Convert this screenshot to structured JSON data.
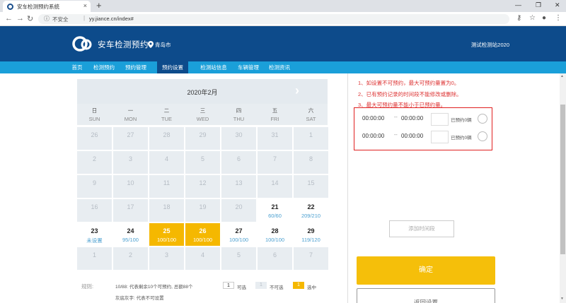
{
  "browser": {
    "tab_title": "安车检测预约系统",
    "tab_close": "×",
    "new_tab": "+",
    "security_label": "不安全",
    "separator": "|",
    "url": "yy.jiance.cn/index#"
  },
  "header": {
    "brand": "安车检测预约",
    "city": "青岛市",
    "station": "测试检测站2020"
  },
  "nav": {
    "items": [
      {
        "label": "首页",
        "active": false
      },
      {
        "label": "检测预约",
        "active": false
      },
      {
        "label": "预约管理",
        "active": false
      },
      {
        "label": "预约设置",
        "active": true
      },
      {
        "label": "检测站信息",
        "active": false
      },
      {
        "label": "车辆管理",
        "active": false
      },
      {
        "label": "检测资讯",
        "active": false
      }
    ]
  },
  "calendar": {
    "title": "2020年2月",
    "next_arrow": "›",
    "weekdays": [
      {
        "cn": "日",
        "en": "SUN"
      },
      {
        "cn": "一",
        "en": "MON"
      },
      {
        "cn": "二",
        "en": "TUE"
      },
      {
        "cn": "三",
        "en": "WED"
      },
      {
        "cn": "四",
        "en": "THU"
      },
      {
        "cn": "五",
        "en": "FRI"
      },
      {
        "cn": "六",
        "en": "SAT"
      }
    ],
    "weeks": [
      [
        {
          "n": "26",
          "s": "",
          "t": "off"
        },
        {
          "n": "27",
          "s": "",
          "t": "off"
        },
        {
          "n": "28",
          "s": "",
          "t": "off"
        },
        {
          "n": "29",
          "s": "",
          "t": "off"
        },
        {
          "n": "30",
          "s": "",
          "t": "off"
        },
        {
          "n": "31",
          "s": "",
          "t": "off"
        },
        {
          "n": "1",
          "s": "",
          "t": "off"
        }
      ],
      [
        {
          "n": "2",
          "s": "",
          "t": "off"
        },
        {
          "n": "3",
          "s": "",
          "t": "off"
        },
        {
          "n": "4",
          "s": "",
          "t": "off"
        },
        {
          "n": "5",
          "s": "",
          "t": "off"
        },
        {
          "n": "6",
          "s": "",
          "t": "off"
        },
        {
          "n": "7",
          "s": "",
          "t": "off"
        },
        {
          "n": "8",
          "s": "",
          "t": "off"
        }
      ],
      [
        {
          "n": "9",
          "s": "",
          "t": "off"
        },
        {
          "n": "10",
          "s": "",
          "t": "off"
        },
        {
          "n": "11",
          "s": "",
          "t": "off"
        },
        {
          "n": "12",
          "s": "",
          "t": "off"
        },
        {
          "n": "13",
          "s": "",
          "t": "off"
        },
        {
          "n": "14",
          "s": "",
          "t": "off"
        },
        {
          "n": "15",
          "s": "",
          "t": "off"
        }
      ],
      [
        {
          "n": "16",
          "s": "",
          "t": "off"
        },
        {
          "n": "17",
          "s": "",
          "t": "off"
        },
        {
          "n": "18",
          "s": "",
          "t": "off"
        },
        {
          "n": "19",
          "s": "",
          "t": "off"
        },
        {
          "n": "20",
          "s": "",
          "t": "off"
        },
        {
          "n": "21",
          "s": "60/60",
          "t": "avail"
        },
        {
          "n": "22",
          "s": "209/210",
          "t": "avail"
        }
      ],
      [
        {
          "n": "23",
          "s": "未设置",
          "t": "avail"
        },
        {
          "n": "24",
          "s": "95/100",
          "t": "avail"
        },
        {
          "n": "25",
          "s": "100/100",
          "t": "selected"
        },
        {
          "n": "26",
          "s": "100/100",
          "t": "selected"
        },
        {
          "n": "27",
          "s": "100/100",
          "t": "avail"
        },
        {
          "n": "28",
          "s": "100/100",
          "t": "avail"
        },
        {
          "n": "29",
          "s": "119/120",
          "t": "avail"
        }
      ],
      [
        {
          "n": "1",
          "s": "",
          "t": "off"
        },
        {
          "n": "2",
          "s": "",
          "t": "off"
        },
        {
          "n": "3",
          "s": "",
          "t": "off"
        },
        {
          "n": "4",
          "s": "",
          "t": "off"
        },
        {
          "n": "5",
          "s": "",
          "t": "off"
        },
        {
          "n": "6",
          "s": "",
          "t": "off"
        },
        {
          "n": "7",
          "s": "",
          "t": "off"
        }
      ]
    ]
  },
  "legend": {
    "label": "规则:",
    "text1": "10/88: 代表剩余10个可预约, 总额88个",
    "text2": "灰底灰字: 代表不可设置",
    "sample_num": "1",
    "available": "可选",
    "unavailable": "不可选",
    "selected": "选中"
  },
  "rules": [
    "1、如设置不可预约，最大可预约量置为0。",
    "2、已有预约记录的时间段不能修改或删除。",
    "3、最大可预约量不能小于已预约量。"
  ],
  "slots": [
    {
      "start": "00:00:00",
      "dash": "--",
      "end": "00:00:00",
      "qty": "",
      "booked": "已预约0辆"
    },
    {
      "start": "00:00:00",
      "dash": "--",
      "end": "00:00:00",
      "qty": "",
      "booked": "已预约0辆"
    }
  ],
  "buttons": {
    "add_slot": "添加时间段",
    "confirm": "确定",
    "back": "返回设置"
  },
  "colors": {
    "header_bg": "#0d4b8b",
    "nav_bg": "#1a9fd9",
    "selected_day": "#f5b800",
    "confirm": "#f5bf0a",
    "rule_text": "#d33333"
  }
}
